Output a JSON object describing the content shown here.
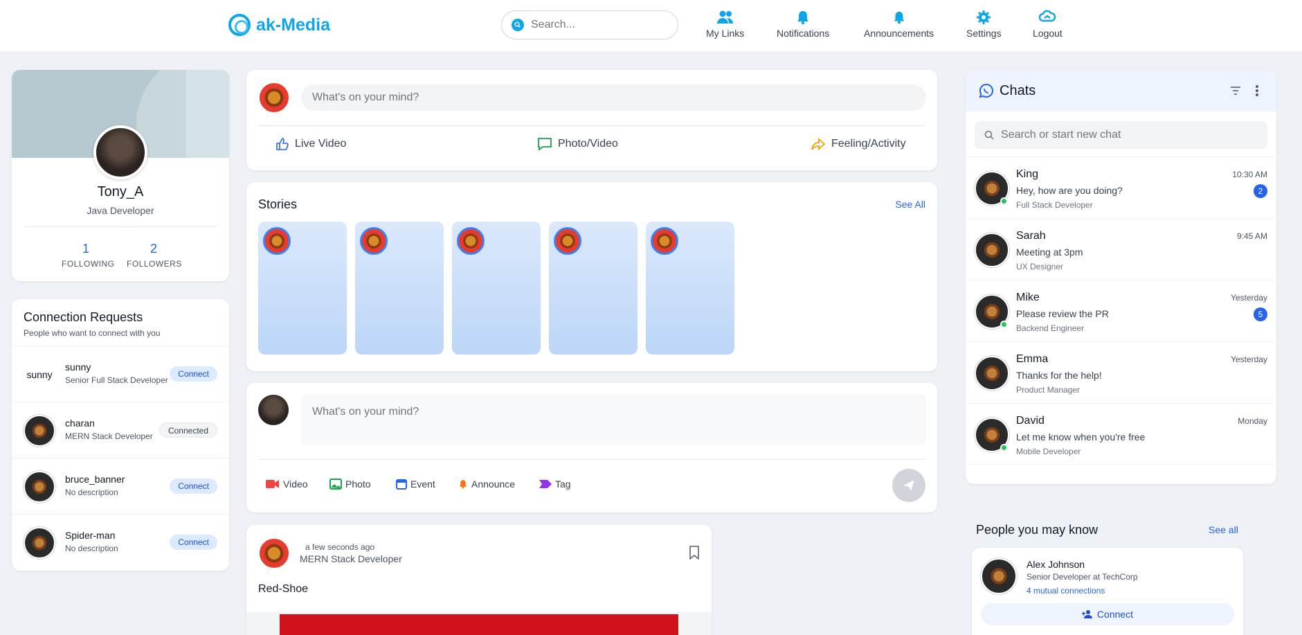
{
  "brand": {
    "name": "ak-Media",
    "accent": "#0ea5e9"
  },
  "search": {
    "placeholder": "Search..."
  },
  "nav": [
    {
      "label": "My Links",
      "icon": "users-icon"
    },
    {
      "label": "Notifications",
      "icon": "bell-icon"
    },
    {
      "label": "Announcements",
      "icon": "bell-icon"
    },
    {
      "label": "Settings",
      "icon": "gear-icon"
    },
    {
      "label": "Logout",
      "icon": "logout-icon"
    }
  ],
  "profile": {
    "name": "Tony_A",
    "title": "Java Developer",
    "following": "1",
    "following_label": "FOLLOWING",
    "followers": "2",
    "followers_label": "FOLLOWERS"
  },
  "connections": {
    "title": "Connection Requests",
    "subtitle": "People who want to connect with you",
    "items": [
      {
        "name": "sunny",
        "desc": "Senior Full Stack Developer",
        "action": "Connect",
        "alt": "sunny"
      },
      {
        "name": "charan",
        "desc": "MERN Stack Developer",
        "action": "Connected"
      },
      {
        "name": "bruce_banner",
        "desc": "No description",
        "action": "Connect"
      },
      {
        "name": "Spider-man",
        "desc": "No description",
        "action": "Connect"
      }
    ]
  },
  "composer": {
    "placeholder": "What's on your mind?",
    "actions": [
      "Live Video",
      "Photo/Video",
      "Feeling/Activity"
    ]
  },
  "stories": {
    "title": "Stories",
    "see_all": "See All",
    "count": 5
  },
  "composer2": {
    "placeholder": "What's on your mind?",
    "tools": [
      "Video",
      "Photo",
      "Event",
      "Announce",
      "Tag"
    ]
  },
  "post": {
    "time": "a few seconds ago",
    "role": "MERN Stack Developer",
    "text": "Red-Shoe"
  },
  "chats": {
    "title": "Chats",
    "search_placeholder": "Search or start new chat",
    "items": [
      {
        "name": "King",
        "message": "Hey, how are you doing?",
        "role": "Full Stack Developer",
        "time": "10:30 AM",
        "unread": "2",
        "online": true
      },
      {
        "name": "Sarah",
        "message": "Meeting at 3pm",
        "role": "UX Designer",
        "time": "9:45 AM",
        "unread": "",
        "online": false
      },
      {
        "name": "Mike",
        "message": "Please review the PR",
        "role": "Backend Engineer",
        "time": "Yesterday",
        "unread": "5",
        "online": true
      },
      {
        "name": "Emma",
        "message": "Thanks for the help!",
        "role": "Product Manager",
        "time": "Yesterday",
        "unread": "",
        "online": false
      },
      {
        "name": "David",
        "message": "Let me know when you're free",
        "role": "Mobile Developer",
        "time": "Monday",
        "unread": "",
        "online": true
      }
    ]
  },
  "people": {
    "title": "People you may know",
    "see_all": "See all",
    "items": [
      {
        "name": "Alex Johnson",
        "role": "Senior Developer at TechCorp",
        "mutual": "4 mutual connections",
        "action": "Connect"
      }
    ]
  }
}
